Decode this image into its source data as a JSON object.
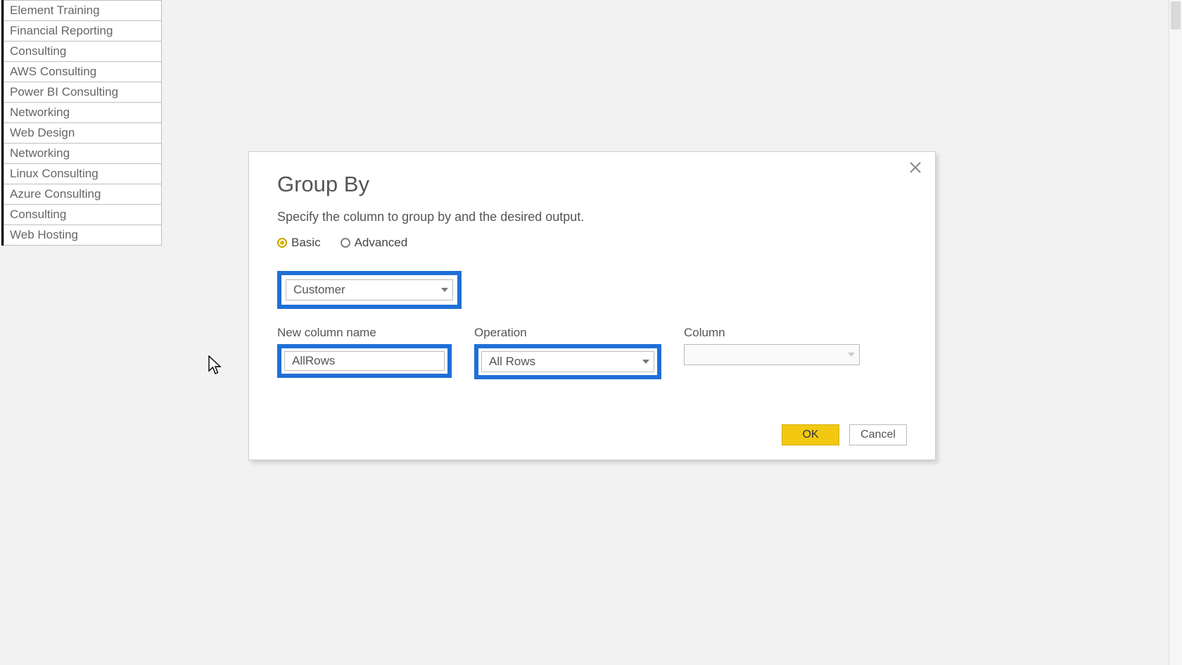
{
  "column_values": [
    "Element Training",
    "Financial Reporting",
    "Consulting",
    "AWS Consulting",
    "Power BI Consulting",
    "Networking",
    "Web Design",
    "Networking",
    "Linux Consulting",
    "Azure Consulting",
    "Consulting",
    "Web Hosting"
  ],
  "dialog": {
    "title": "Group By",
    "subtitle": "Specify the column to group by and the desired output.",
    "mode": {
      "basic_label": "Basic",
      "advanced_label": "Advanced",
      "selected": "basic"
    },
    "groupby_column": "Customer",
    "fields": {
      "new_column_label": "New column name",
      "new_column_value": "AllRows",
      "operation_label": "Operation",
      "operation_value": "All Rows",
      "column_label": "Column",
      "column_value": ""
    },
    "buttons": {
      "ok": "OK",
      "cancel": "Cancel"
    }
  }
}
